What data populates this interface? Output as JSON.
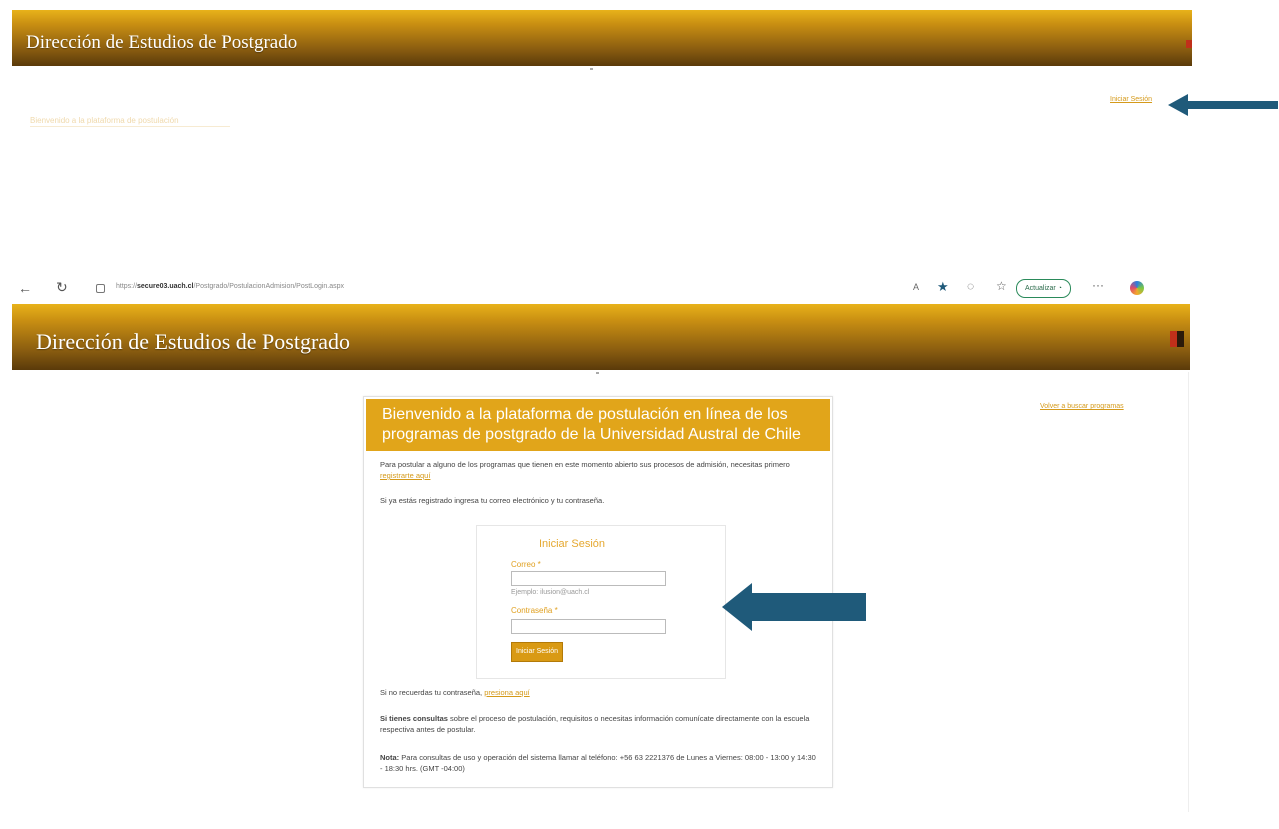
{
  "top_crop": {
    "banner_title": "Dirección de Estudios de Postgrado",
    "faded_text": "Bienvenido a la plataforma de postulación",
    "login_link": "Iniciar Sesión"
  },
  "browser": {
    "back_icon": "←",
    "refresh_icon": "↻",
    "lock_icon": "🔒",
    "url_prefix": "https://",
    "url_domain": "secure03.uach.cl",
    "url_path": "/Postgrado/PostulacionAdmision/PostLogin.aspx",
    "update_button": "Actualizar"
  },
  "site": {
    "banner_title": "Dirección de Estudios de Postgrado",
    "back_link": "Volver a buscar programas"
  },
  "panel": {
    "header": "Bienvenido a la plataforma de postulación en línea de los programas de postgrado de la Universidad Austral de Chile",
    "intro_text": "Para postular a alguno de los programas que tienen en este momento abierto sus procesos de admisión, necesitas primero",
    "intro_link": "registrarte aquí",
    "registered_text": "Si ya estás registrado ingresa tu correo electrónico y tu contraseña.",
    "login": {
      "title": "Iniciar Sesión",
      "email_label": "Correo *",
      "email_value": "",
      "email_example": "Ejemplo: ilusion@uach.cl",
      "password_label": "Contraseña *",
      "password_value": "",
      "submit": "Iniciar Sesión"
    },
    "forgot_text": "Si no recuerdas tu contraseña,",
    "forgot_link": "presiona aquí",
    "consult_bold": "Si tienes consultas",
    "consult_text": "sobre el proceso de postulación, requisitos o necesitas información comunícate directamente con la escuela respectiva antes de postular.",
    "note_bold": "Nota:",
    "note_text": "Para consultas de uso y operación del sistema llamar al teléfono: +56 63 2221376 de Lunes a Viernes: 08:00 - 13:00 y 14:30 - 18:30 hrs. (GMT -04:00)"
  },
  "colors": {
    "accent": "#e1a51a",
    "arrow": "#1f5a7a",
    "link": "#d59a1a"
  }
}
